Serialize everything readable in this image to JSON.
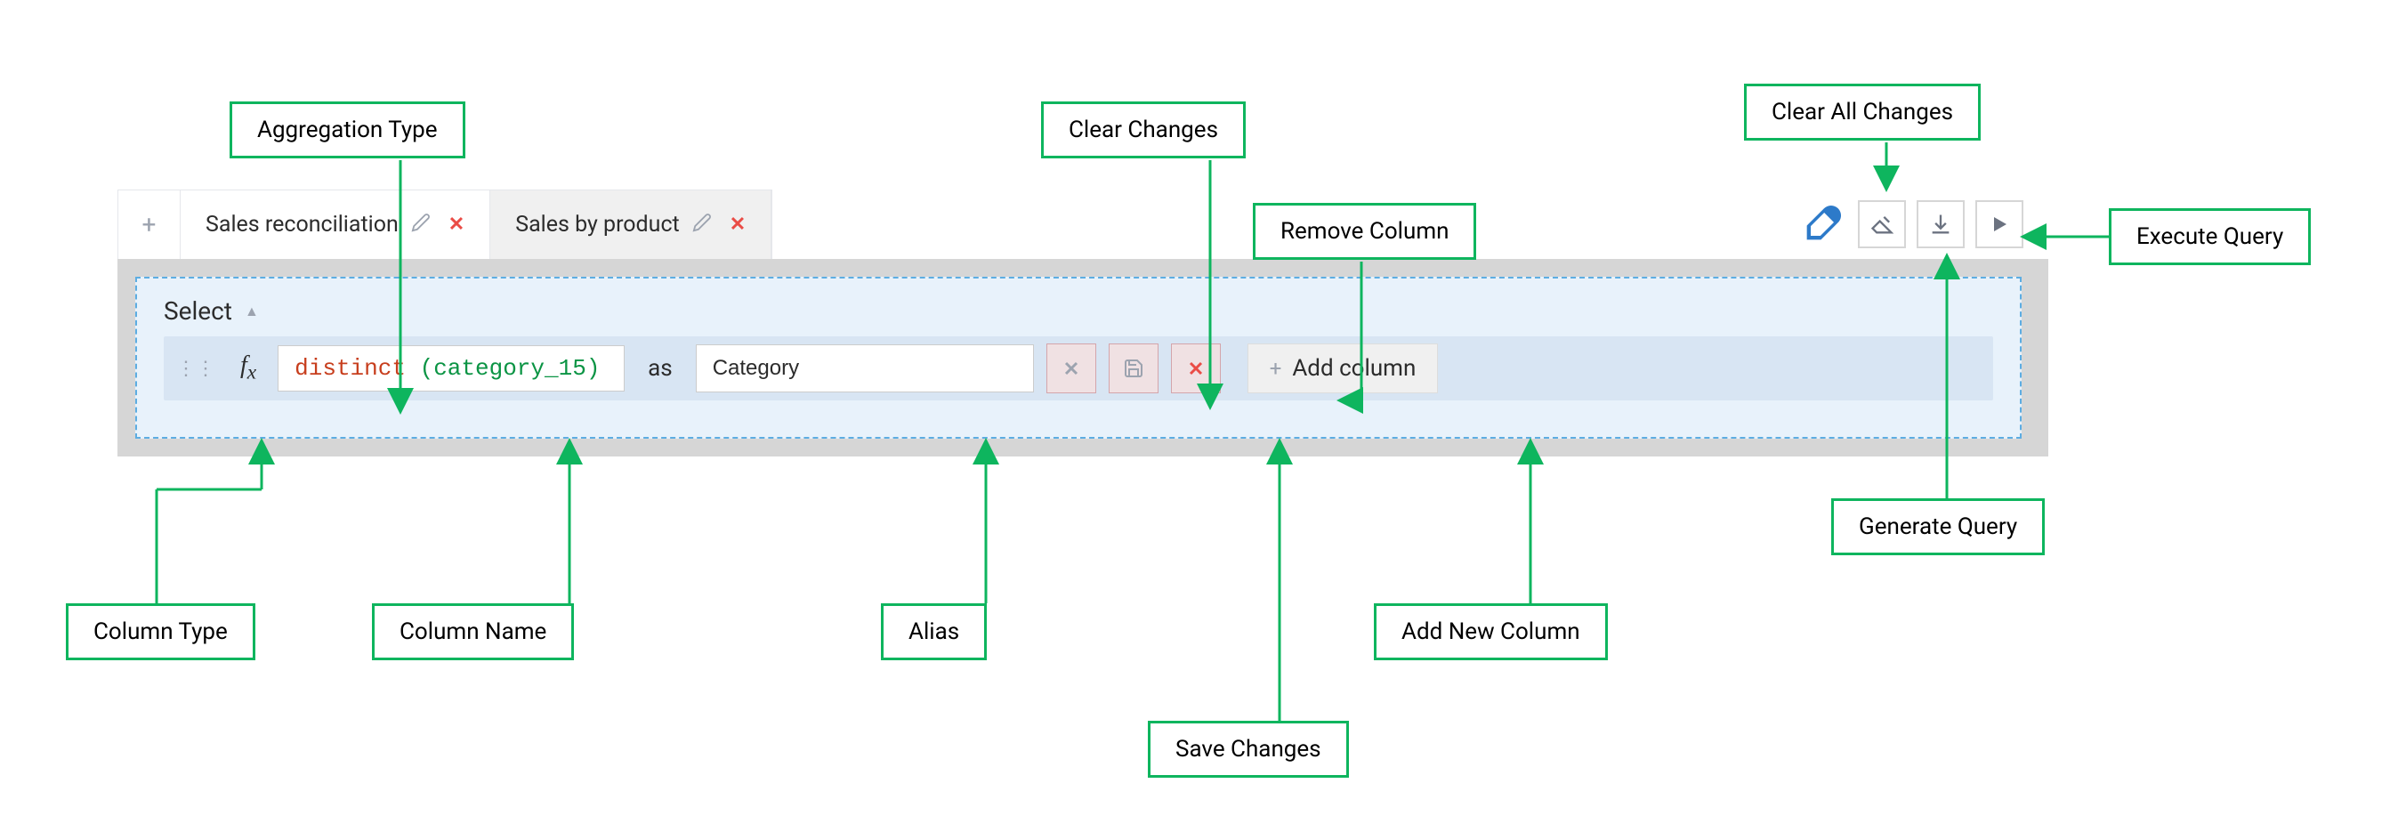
{
  "tabs": {
    "tab1": "Sales reconciliation",
    "tab2": "Sales by product"
  },
  "selectSection": {
    "header": "Select",
    "columnRow": {
      "distinctKeyword": "distinct",
      "columnExpr": "category_15",
      "asLabel": "as",
      "aliasValue": "Category",
      "addColumnLabel": "Add column"
    }
  },
  "callouts": {
    "aggregationType": "Aggregation Type",
    "clearChanges": "Clear Changes",
    "clearAllChanges": "Clear All Changes",
    "removeColumn": "Remove Column",
    "executeQuery": "Execute Query",
    "columnType": "Column Type",
    "columnName": "Column Name",
    "alias": "Alias",
    "saveChanges": "Save Changes",
    "addNewColumn": "Add New Column",
    "generateQuery": "Generate Query"
  }
}
